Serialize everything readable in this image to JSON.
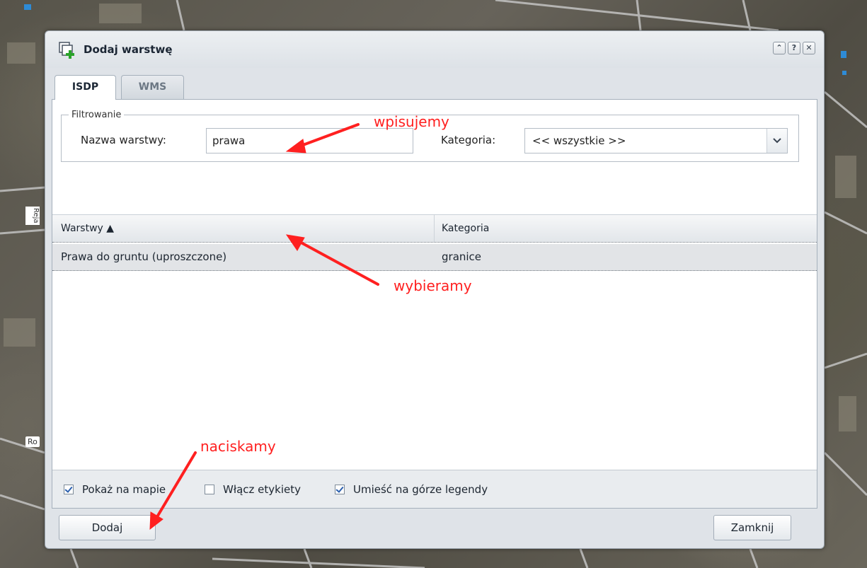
{
  "dialog": {
    "title": "Dodaj warstwę",
    "tool_buttons": [
      "⌃",
      "?",
      "✕"
    ]
  },
  "tabs": [
    {
      "label": "ISDP",
      "active": true
    },
    {
      "label": "WMS",
      "active": false
    }
  ],
  "filter": {
    "legend": "Filtrowanie",
    "name_label": "Nazwa warstwy:",
    "name_value": "prawa",
    "category_label": "Kategoria:",
    "category_value": "<< wszystkie >>"
  },
  "grid": {
    "columns": [
      "Warstwy ▲",
      "Kategoria"
    ],
    "rows": [
      {
        "layer": "Prawa do gruntu (uproszczone)",
        "category": "granice"
      }
    ]
  },
  "options": [
    {
      "label": "Pokaż na mapie",
      "checked": true
    },
    {
      "label": "Włącz etykiety",
      "checked": false
    },
    {
      "label": "Umieść na górze legendy",
      "checked": true
    }
  ],
  "buttons": {
    "add": "Dodaj",
    "close": "Zamknij"
  },
  "annotations": {
    "type": "wpisujemy",
    "select": "wybieramy",
    "press": "naciskamy"
  },
  "map_labels": [
    "Reja",
    "Ro"
  ],
  "colors": {
    "annotation": "#ff2020",
    "dialog_bg": "#dfe3e8",
    "selected_row": "#e2e4e7"
  }
}
